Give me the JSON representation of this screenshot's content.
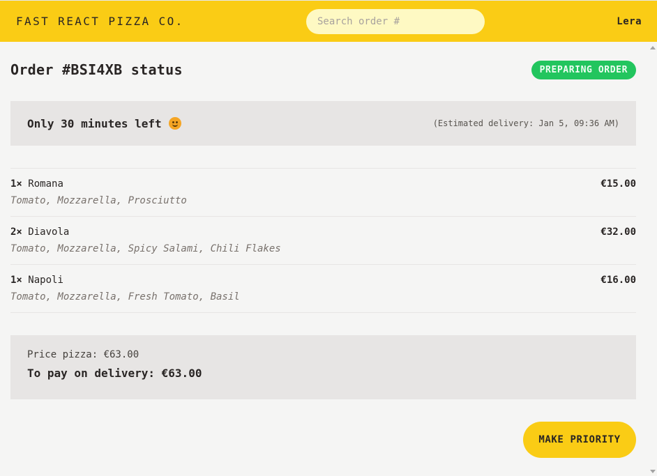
{
  "header": {
    "logo": "FAST REACT PIZZA CO.",
    "search_placeholder": "Search order #",
    "username": "Lera"
  },
  "order": {
    "title": "Order #BSI4XB status",
    "status_badge": "PREPARING ORDER",
    "eta_text": "Only 30 minutes left",
    "eta_icon": "smiley-emoji-icon",
    "estimated_delivery": "(Estimated delivery: Jan 5, 09:36 AM)"
  },
  "items": [
    {
      "qty": "1×",
      "name": "Romana",
      "price": "€15.00",
      "ingredients": "Tomato, Mozzarella, Prosciutto"
    },
    {
      "qty": "2×",
      "name": "Diavola",
      "price": "€32.00",
      "ingredients": "Tomato, Mozzarella, Spicy Salami, Chili Flakes"
    },
    {
      "qty": "1×",
      "name": "Napoli",
      "price": "€16.00",
      "ingredients": "Tomato, Mozzarella, Fresh Tomato, Basil"
    }
  ],
  "summary": {
    "price_pizza": "Price pizza: €63.00",
    "to_pay": "To pay on delivery: €63.00"
  },
  "actions": {
    "make_priority": "MAKE PRIORITY"
  },
  "colors": {
    "brand_yellow": "#facc15",
    "status_green": "#22c55e",
    "panel_gray": "#e7e5e4"
  }
}
